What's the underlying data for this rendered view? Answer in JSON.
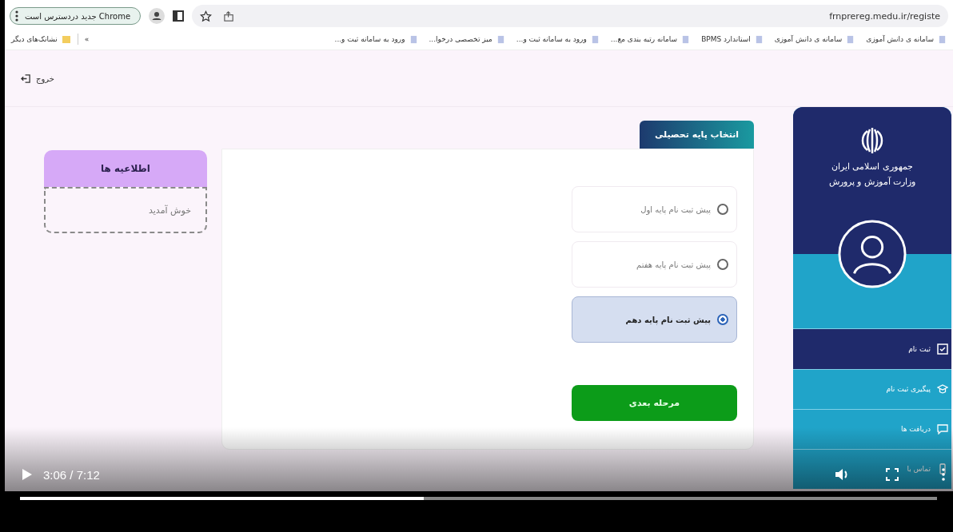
{
  "browser": {
    "update_chip": "Chrome جدید دردسترس است",
    "url": "frnprereg.medu.ir/registe"
  },
  "bookmarks": [
    {
      "label": "سامانه ی دانش آموزی"
    },
    {
      "label": "سامانه ی دانش آموزی"
    },
    {
      "label": "استاندارد BPMS"
    },
    {
      "label": "سامانه رتبه بندی مع..."
    },
    {
      "label": "ورود به سامانه ثبت و..."
    },
    {
      "label": "میز تخصصی درخوا..."
    },
    {
      "label": "ورود به سامانه ثبت و..."
    }
  ],
  "bookmarks_more": "»",
  "other_bookmarks": "نشانک‌های دیگر",
  "header": {
    "logout": "خروج"
  },
  "notices": {
    "title": "اطلاعیه ها",
    "body": "خوش آمدید"
  },
  "grade_form": {
    "tab": "انتخاب پایه تحصیلی",
    "options": [
      {
        "label": "پیش ثبت نام پایه اول",
        "selected": false
      },
      {
        "label": "پیش ثبت نام پایه هفتم",
        "selected": false
      },
      {
        "label": "پیش ثبت نام پایه دهم",
        "selected": true
      }
    ],
    "next_button": "مرحله بعدی"
  },
  "sidebar": {
    "org_line_1": "جمهوری اسلامی ایران",
    "org_line_2": "وزارت آموزش و پرورش",
    "items": [
      {
        "label": "ثبت نام",
        "selected": true
      },
      {
        "label": "پیگیری ثبت نام",
        "selected": false
      },
      {
        "label": "دریافت ها",
        "selected": false
      },
      {
        "label": "تماس با",
        "selected": false
      }
    ]
  },
  "player": {
    "time": "3:06 / 7:12",
    "playing": false,
    "level": 0.44
  }
}
